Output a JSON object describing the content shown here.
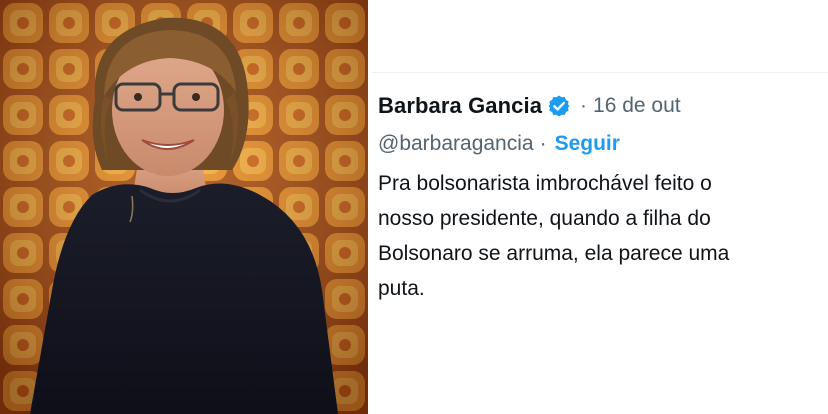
{
  "tweet": {
    "display_name": "Barbara Gancia",
    "verified": true,
    "separator": "·",
    "date": "16 de out",
    "handle": "@barbaragancia",
    "handle_separator": "·",
    "follow_label": "Seguir",
    "text_lines": [
      "Pra bolsonarista imbrochável feito o",
      "nosso presidente, quando a filha do",
      "Bolsonaro se arruma, ela parece uma",
      "puta."
    ]
  },
  "colors": {
    "name": "#0f1419",
    "secondary": "#536471",
    "accent": "#1d9bf0",
    "photo_background": "#c8621c"
  },
  "icons": {
    "verified": "verified-badge-icon"
  }
}
